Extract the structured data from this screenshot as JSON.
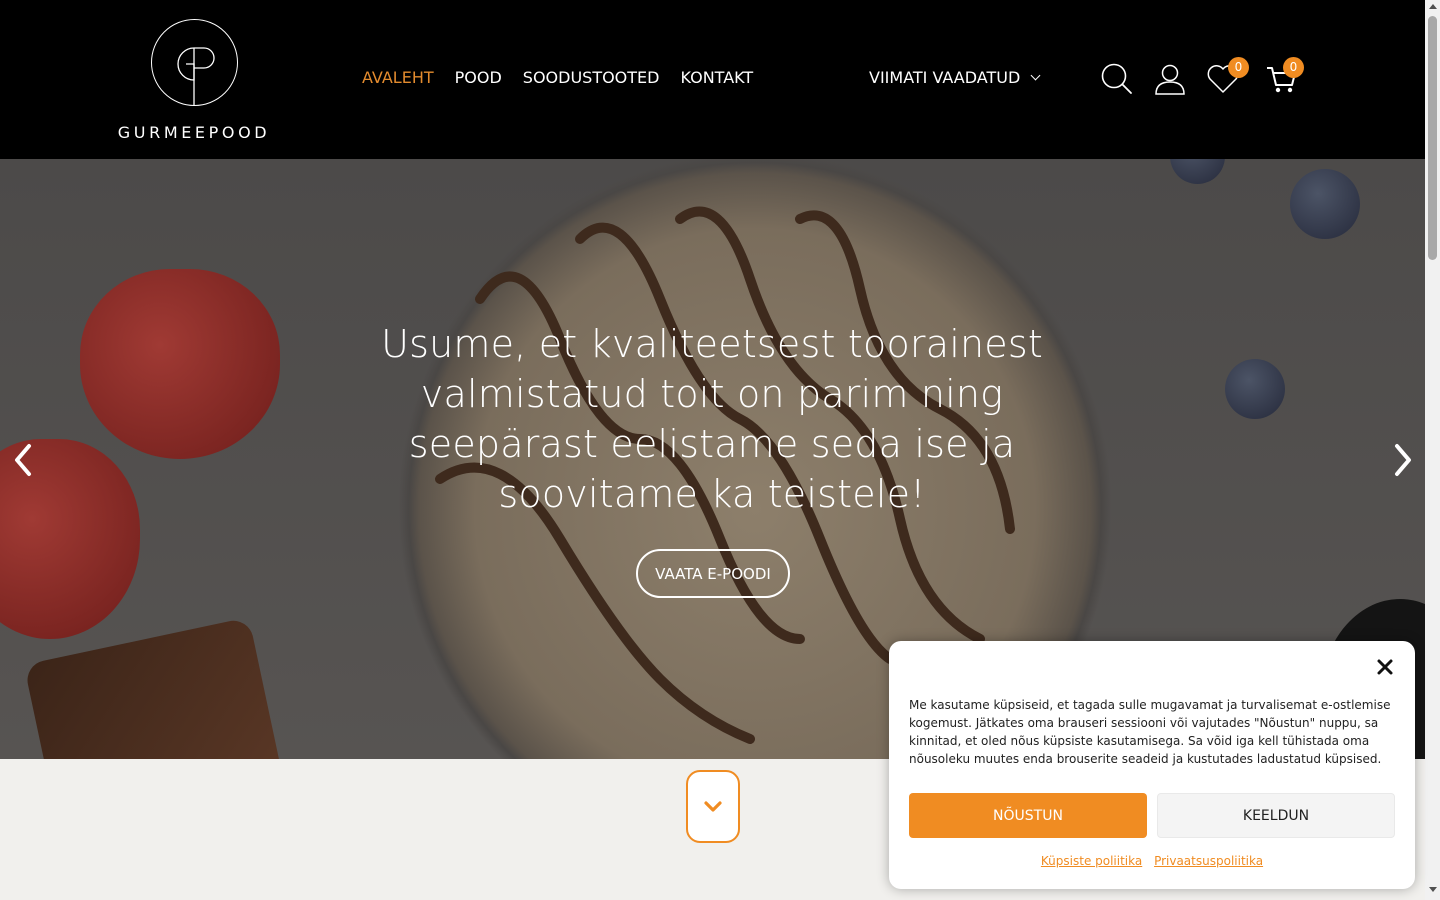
{
  "brand": {
    "logo_text": "GURMEEPOOD"
  },
  "nav": {
    "items": [
      {
        "label": "AVALEHT",
        "active": true
      },
      {
        "label": "POOD",
        "active": false
      },
      {
        "label": "SOODUSTOOTED",
        "active": false
      },
      {
        "label": "KONTAKT",
        "active": false
      }
    ]
  },
  "header": {
    "recently_viewed_label": "VIIMATI VAADATUD",
    "wishlist_count": "0",
    "cart_count": "0",
    "icons": [
      "search-icon",
      "user-icon",
      "heart-icon",
      "cart-icon"
    ]
  },
  "hero": {
    "title": "Usume, et kvaliteetsest toorainest valmistatud toit on parim ning seepärast eelistame seda ise ja soovitame ka teistele!",
    "button_label": "VAATA E-POODI"
  },
  "cookie": {
    "text": "Me kasutame küpsiseid, et tagada sulle mugavamat ja turvalisemat e-ostlemise kogemust. Jätkates oma brauseri sessiooni või vajutades \"Nõustun\" nuppu, sa kinnitad, et oled nõus küpsiste kasutamisega. Sa võid iga kell tühistada oma nõusoleku muutes enda brouserite seadeid ja kustutades ladustatud küpsised.",
    "accept_label": "NÕUSTUN",
    "deny_label": "KEELDUN",
    "links": [
      "Küpsiste poliitika",
      "Privaatsuspoliitika"
    ]
  },
  "colors": {
    "accent": "#f08c22",
    "nav_active": "#e38b2e",
    "header_bg": "#000000",
    "page_bg": "#f1f0ed"
  }
}
